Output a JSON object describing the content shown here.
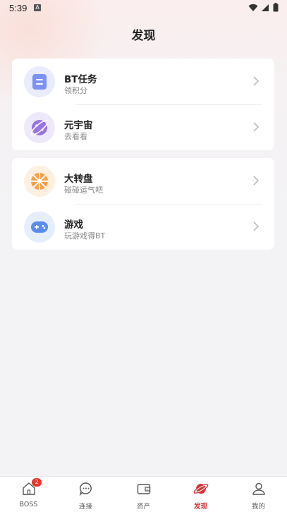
{
  "status_bar": {
    "time": "5:39",
    "notif_icon": "A"
  },
  "header": {
    "title": "发现"
  },
  "sections": [
    {
      "items": [
        {
          "title": "BT任务",
          "subtitle": "领积分",
          "icon": "task-list-icon",
          "icon_color": "#7c93f5"
        },
        {
          "title": "元宇宙",
          "subtitle": "去看看",
          "icon": "planet-icon",
          "icon_color": "#9a74e6"
        }
      ]
    },
    {
      "items": [
        {
          "title": "大转盘",
          "subtitle": "碰碰运气吧",
          "icon": "wheel-icon",
          "icon_color": "#f6a24a"
        },
        {
          "title": "游戏",
          "subtitle": "玩游戏得BT",
          "icon": "gamepad-icon",
          "icon_color": "#5b8cf0"
        }
      ]
    }
  ],
  "tabbar": {
    "tabs": [
      {
        "label": "BOSS",
        "badge": "2"
      },
      {
        "label": "连接"
      },
      {
        "label": "资产"
      },
      {
        "label": "发现"
      },
      {
        "label": "我的"
      }
    ],
    "active_tab": "发现",
    "active_color": "#d4363a"
  }
}
